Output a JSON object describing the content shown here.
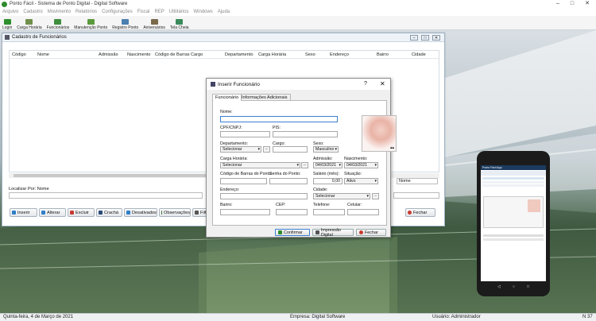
{
  "window": {
    "title": "Ponto Fácil - Sistema de Ponto Digital - Digital Software"
  },
  "menu": [
    "Arquivo",
    "Cadastro",
    "Movimento",
    "Relatórios",
    "Configurações",
    "Fiscal",
    "REP",
    "Utilitários",
    "Windows",
    "Ajuda"
  ],
  "toolbar": [
    {
      "label": "Login",
      "color": "#2d8f2d"
    },
    {
      "label": "Carga Horária",
      "color": "#6f8f4a"
    },
    {
      "label": "Funcionários",
      "color": "#3e8e3e"
    },
    {
      "label": "Manutenção Ponto",
      "color": "#5a9a3c"
    },
    {
      "label": "Registro Ponto",
      "color": "#4a7fb0"
    },
    {
      "label": "Aniversários",
      "color": "#7a6a4a"
    },
    {
      "label": "Tela Cheia",
      "color": "#3a8a5a"
    }
  ],
  "cadastro": {
    "title": "Cadastro de Funcionários",
    "columns": [
      "Código",
      "Nome",
      "Admissão",
      "Nascimento",
      "Código de Barras",
      "Cargo",
      "Departamento",
      "Carga Horária",
      "Sexo",
      "Endereço",
      "Bairro",
      "Cidade"
    ],
    "localizar_label": "Localizar Por:",
    "localizar_field": "Nome",
    "filtro_value": "Nome",
    "buttons": [
      "Inserir",
      "Alterar",
      "Excluir",
      "Crachá",
      "Desativados",
      "Observações",
      "Filt",
      "Fechar"
    ]
  },
  "dialog": {
    "title": "Inserir Funcionário",
    "help": "?",
    "close": "✕",
    "tabs": [
      "Funcionário",
      "Informações Adicionais"
    ],
    "labels": {
      "nome": "Nome:",
      "cpf": "CPF/CNPJ:",
      "pis": "PIS:",
      "departamento": "Departamento:",
      "cargo": "Cargo:",
      "sexo": "Sexo:",
      "carga": "Carga Horária:",
      "admissao": "Admissão:",
      "nascimento": "Nascimento:",
      "codbarras": "Código de Barras do Ponto:",
      "senha": "Senha do Ponto:",
      "salario": "Salário (mês):",
      "situacao": "Situação:",
      "endereco": "Endereço:",
      "cidade": "Cidade:",
      "bairro": "Bairro:",
      "cep": "CEP:",
      "telefone": "Telefone:",
      "celular": "Celular:"
    },
    "values": {
      "departamento": "Selecionar",
      "sexo": "Masculino",
      "carga": "Selecionar",
      "admissao": "04/03/2021",
      "nascimento": "04/03/2021",
      "salario": "0,00",
      "situacao": "Ativo",
      "cidade": "Selecionar"
    },
    "buttons": [
      "Confirmar",
      "Impressão Digital",
      "Fechar"
    ]
  },
  "status": {
    "date": "Quinta-feira, 4 de Março de 2021",
    "empresa": "Empresa: Digital Software",
    "usuario": "Usuário: Administrador",
    "flag": "N 37"
  },
  "phone": {
    "app_title": "Ponto Fácil App"
  }
}
